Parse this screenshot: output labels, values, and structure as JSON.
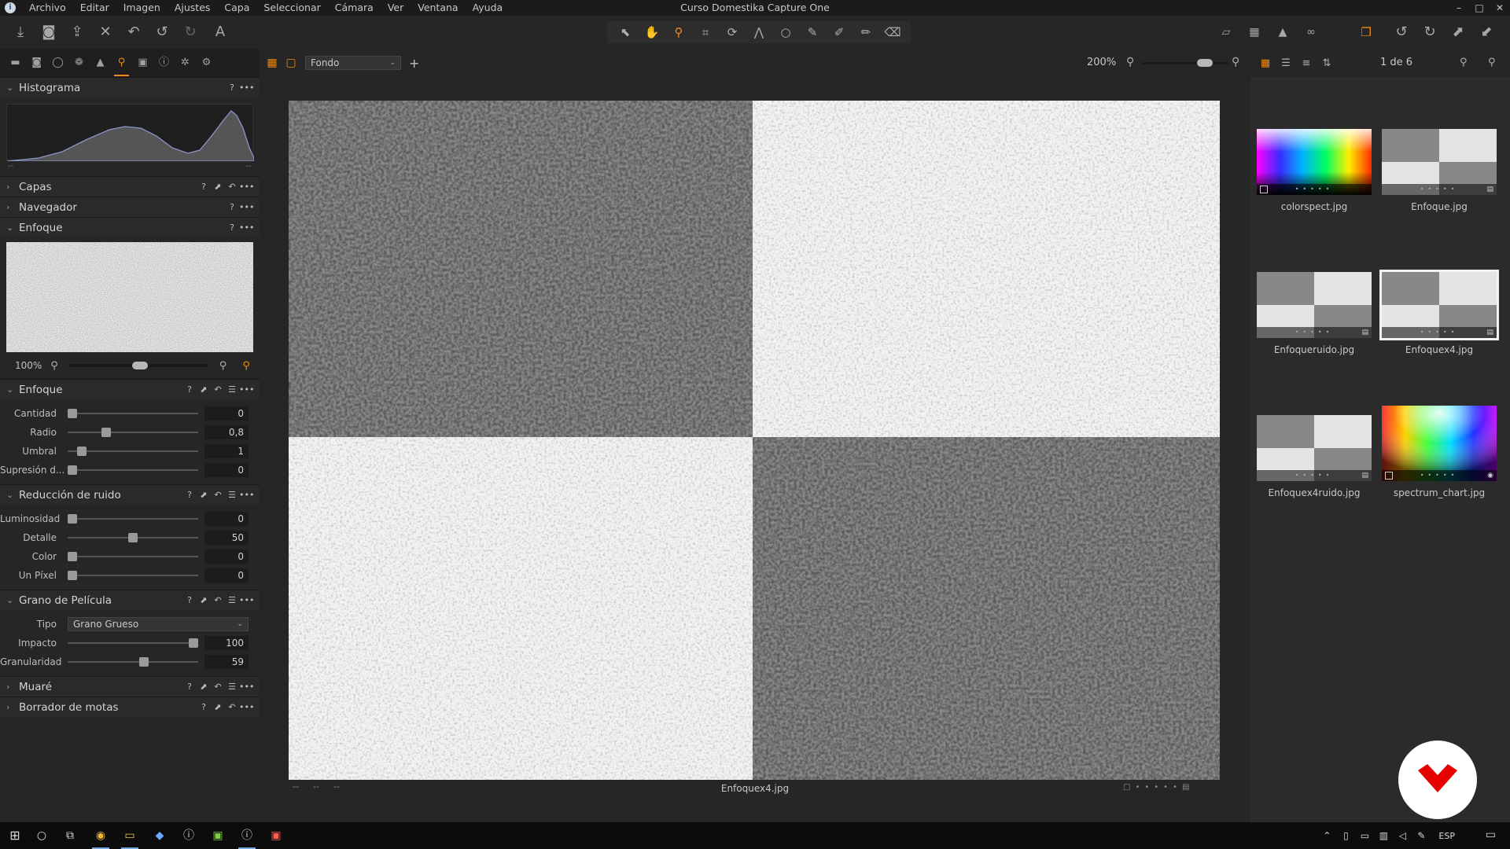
{
  "window": {
    "title": "Curso Domestika Capture One",
    "controls": [
      "–",
      "□",
      "✕"
    ]
  },
  "menu": [
    "Archivo",
    "Editar",
    "Imagen",
    "Ajustes",
    "Capa",
    "Seleccionar",
    "Cámara",
    "Ver",
    "Ventana",
    "Ayuda"
  ],
  "left_panel": {
    "histogram": {
      "title": "Histograma",
      "min_label": "--",
      "max_label": "--"
    },
    "capas": {
      "title": "Capas"
    },
    "navegador": {
      "title": "Navegador"
    },
    "enfoque_preview": {
      "title": "Enfoque",
      "zoom": "100%"
    },
    "enfoque": {
      "title": "Enfoque",
      "sliders": [
        {
          "label": "Cantidad",
          "value": "0",
          "level": 0
        },
        {
          "label": "Radio",
          "value": "0,8",
          "level": 0.28
        },
        {
          "label": "Umbral",
          "value": "1",
          "level": 0.08
        },
        {
          "label": "Supresión d...",
          "value": "0",
          "level": 0
        }
      ]
    },
    "ruido": {
      "title": "Reducción de ruido",
      "sliders": [
        {
          "label": "Luminosidad",
          "value": "0",
          "level": 0
        },
        {
          "label": "Detalle",
          "value": "50",
          "level": 0.5
        },
        {
          "label": "Color",
          "value": "0",
          "level": 0
        },
        {
          "label": "Un Píxel",
          "value": "0",
          "level": 0
        }
      ]
    },
    "grano": {
      "title": "Grano de Película",
      "tipo_label": "Tipo",
      "tipo_value": "Grano Grueso",
      "sliders": [
        {
          "label": "Impacto",
          "value": "100",
          "level": 1.0
        },
        {
          "label": "Granularidad",
          "value": "59",
          "level": 0.59
        }
      ]
    },
    "muare": {
      "title": "Muaré"
    },
    "borrador": {
      "title": "Borrador de motas"
    }
  },
  "viewer": {
    "background_select": "Fondo",
    "zoom": "200%",
    "filename": "Enfoquex4.jpg",
    "footer_dashes": [
      "--",
      "--",
      "--"
    ]
  },
  "browser": {
    "count": "1 de 6",
    "items": [
      {
        "name": "colorspect.jpg",
        "kind": "spectrum"
      },
      {
        "name": "Enfoque.jpg",
        "kind": "checker"
      },
      {
        "name": "Enfoqueruido.jpg",
        "kind": "checker"
      },
      {
        "name": "Enfoquex4.jpg",
        "kind": "checker",
        "selected": true
      },
      {
        "name": "Enfoquex4ruido.jpg",
        "kind": "checker"
      },
      {
        "name": "spectrum_chart.jpg",
        "kind": "wheel"
      }
    ]
  },
  "taskbar": {
    "lang": "ESP"
  },
  "colors": {
    "accent": "#f08a12",
    "brand": "#e60000"
  }
}
